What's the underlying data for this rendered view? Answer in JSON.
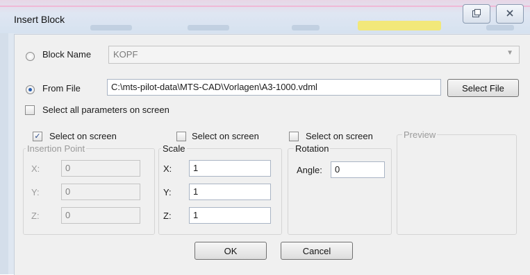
{
  "window": {
    "title": "Insert Block",
    "restore_icon": "restore-icon",
    "close_icon": "close-icon"
  },
  "block_name": {
    "label": "Block Name",
    "value": "KOPF",
    "selected": false
  },
  "from_file": {
    "label": "From File",
    "value": "C:\\mts-pilot-data\\MTS-CAD\\Vorlagen\\A3-1000.vdml",
    "selected": true,
    "select_button": "Select File"
  },
  "select_all_params": {
    "label": "Select all parameters on screen",
    "checked": false
  },
  "insertion_point": {
    "select_on_screen_label": "Select on screen",
    "checked": true,
    "group_label": "Insertion Point",
    "x_label": "X:",
    "x_value": "0",
    "y_label": "Y:",
    "y_value": "0",
    "z_label": "Z:",
    "z_value": "0"
  },
  "scale": {
    "select_on_screen_label": "Select on screen",
    "checked": false,
    "group_label": "Scale",
    "x_label": "X:",
    "x_value": "1",
    "y_label": "Y:",
    "y_value": "1",
    "z_label": "Z:",
    "z_value": "1"
  },
  "rotation": {
    "select_on_screen_label": "Select on screen",
    "checked": false,
    "group_label": "Rotation",
    "angle_label": "Angle:",
    "angle_value": "0"
  },
  "preview": {
    "group_label": "Preview"
  },
  "buttons": {
    "ok": "OK",
    "cancel": "Cancel"
  },
  "colors": {
    "radio_selected": "#2a5fb0",
    "title_highlight": "#f2e87a"
  }
}
